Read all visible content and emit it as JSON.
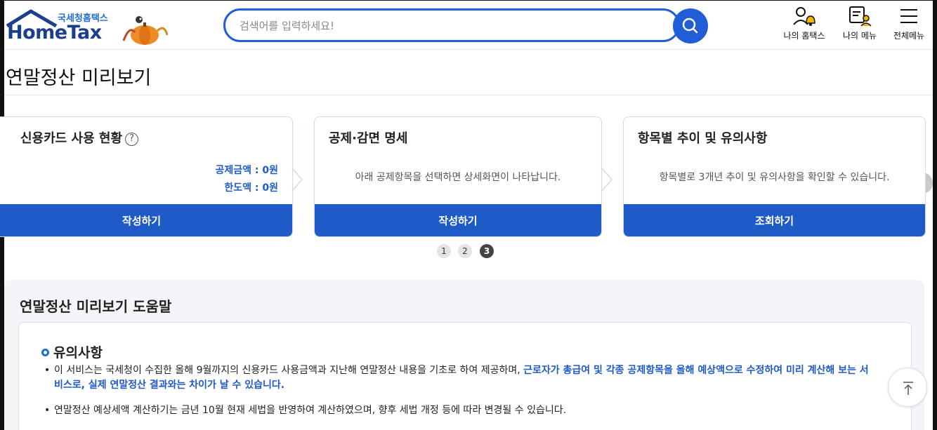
{
  "header": {
    "logo_top": "국세청홈택스",
    "logo_main": "HomeTax",
    "search_placeholder": "검색어를 입력하세요!",
    "menu": [
      {
        "label": "나의 홈택스",
        "icon": "user-bell-icon"
      },
      {
        "label": "나의 메뉴",
        "icon": "doc-user-icon"
      },
      {
        "label": "전체메뉴",
        "icon": "hamburger-icon"
      }
    ]
  },
  "page": {
    "title": "연말정산 미리보기"
  },
  "cards": [
    {
      "title": "신용카드 사용 현황",
      "help_icon": "?",
      "amounts": [
        "공제금액 : 0원",
        "한도액 : 0원"
      ],
      "button": "작성하기"
    },
    {
      "title": "공제·감면 명세",
      "desc": "아래 공제항목을 선택하면 상세화면이 나타납니다.",
      "button": "작성하기"
    },
    {
      "title": "항목별 추이 및 유의사항",
      "desc": "항목별로 3개년 추이 및 유의사항을 확인할 수 있습니다.",
      "button": "조회하기"
    }
  ],
  "pagination": {
    "pages": [
      "1",
      "2",
      "3"
    ],
    "active": "3"
  },
  "help": {
    "title": "연말정산 미리보기 도움말",
    "notice_heading": "유의사항",
    "items": [
      {
        "text": "이 서비스는 국세청이 수집한 올해 9월까지의 신용카드 사용금액과 지난해 연말정산 내용을 기초로 하여 제공하며,",
        "highlight": "근로자가 총급여 및 각종 공제항목을 올해 예상액으로 수정하여 미리 계산해 보는 서비스로, 실제 연말정산 결과와는 차이가 날 수 있습니다."
      },
      {
        "text": "연말정산 예상세액 계산하기는 금년 10월 현재 세법을 반영하여 계산하였으며, 향후 세법 개정 등에 따라 변경될 수 있습니다.",
        "highlight": ""
      }
    ]
  },
  "colors": {
    "primary": "#1f5ac9",
    "search_border": "#1f5ed6",
    "logo_blue": "#1b3f8f"
  }
}
